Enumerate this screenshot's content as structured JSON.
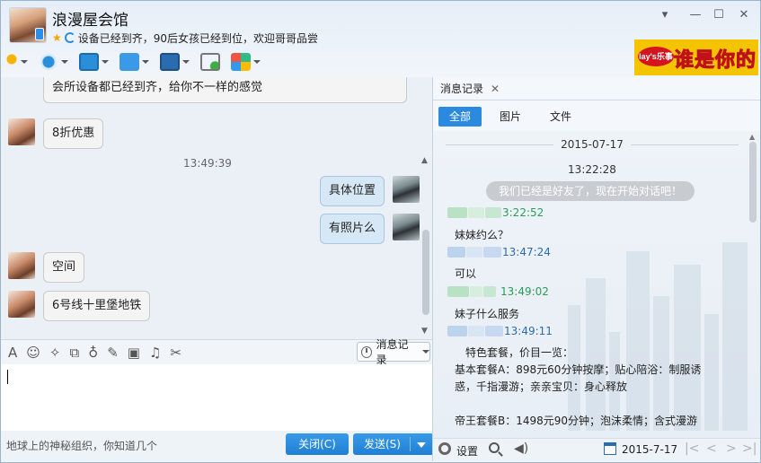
{
  "header": {
    "contact_name": "浪漫屋会馆",
    "signature": "设备已经到齐，90后女孩已经到位，欢迎哥哥品尝",
    "win_min": "▾",
    "win_minimize": "—",
    "win_maximize": "☐",
    "win_close": "✕"
  },
  "ad": {
    "logo": "lay's乐事",
    "slogan": "谁是你的菜"
  },
  "chat": {
    "messages": [
      {
        "side": "left",
        "text": "会所设备都已经到齐，给你不一样的感觉"
      },
      {
        "side": "left",
        "text": "8折优惠"
      },
      {
        "side": "time",
        "text": "13:49:39"
      },
      {
        "side": "right",
        "text": "具体位置"
      },
      {
        "side": "right",
        "text": "有照片么"
      },
      {
        "side": "left",
        "text": "空间"
      },
      {
        "side": "left",
        "text": "6号线十里堡地铁"
      }
    ]
  },
  "input": {
    "history_button": "消息记录",
    "footer_hint": "地球上的神秘组织，你知道几个",
    "close_button": "关闭(C)",
    "send_button": "发送(S)"
  },
  "history": {
    "tab_label": "消息记录",
    "tab_close": "✕",
    "filters": [
      "全部",
      "图片",
      "文件"
    ],
    "date_header": "2015-07-17",
    "system_time": "13:22:28",
    "system_message": "我们已经是好友了，现在开始对话吧！",
    "entries": [
      {
        "time": "3:22:52",
        "text": [
          "妹妹约么？"
        ]
      },
      {
        "time": "13:47:24",
        "text": [
          "可以"
        ]
      },
      {
        "time": "13:49:02",
        "text": [
          "妹子什么服务"
        ]
      },
      {
        "time": "13:49:11",
        "text": [
          "　特色套餐，价目一览：",
          "基本套餐A：898元60分钟按摩；贴心陪浴：制服诱",
          "惑，千指漫游；亲亲宝贝：身心释放",
          "",
          "帝王套餐B：1498元90分钟；泡沫柔情；含式漫游"
        ]
      }
    ],
    "footer_settings": "设置",
    "footer_date": "2015-7-17"
  },
  "colors": {
    "accent": "#2b8ae0",
    "self_time": "#2a9d57",
    "other_time": "#2b6cb0"
  }
}
